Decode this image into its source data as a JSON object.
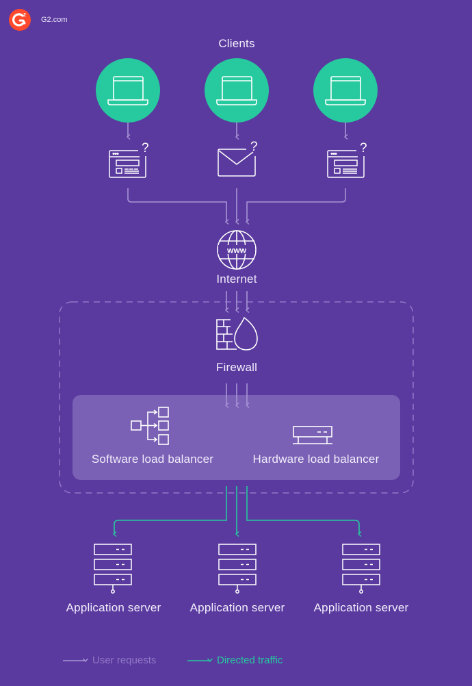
{
  "brand": {
    "label": "G2.com",
    "logo_icon": "g2-logo-icon",
    "logo_color": "#ff492c"
  },
  "colors": {
    "background": "#5a3a9e",
    "client_circle": "#27c99f",
    "user_request_arrow": "#a894d6",
    "directed_traffic_arrow": "#27c99f",
    "lb_panel": "#7a61b5"
  },
  "clients": {
    "title": "Clients",
    "items": [
      {
        "device": "laptop-icon",
        "request": "browser-window-icon",
        "badge": "?"
      },
      {
        "device": "laptop-icon",
        "request": "envelope-icon",
        "badge": "?"
      },
      {
        "device": "laptop-icon",
        "request": "browser-window-icon",
        "badge": "?"
      }
    ]
  },
  "internet": {
    "label": "Internet",
    "icon": "globe-www-icon",
    "icon_text": "www"
  },
  "firewall": {
    "label": "Firewall",
    "icon": "firewall-icon"
  },
  "load_balancers": [
    {
      "label": "Software load balancer",
      "icon": "tree-distribution-icon"
    },
    {
      "label": "Hardware load balancer",
      "icon": "hardware-device-icon"
    }
  ],
  "servers": [
    {
      "label": "Application server",
      "icon": "server-stack-icon"
    },
    {
      "label": "Application server",
      "icon": "server-stack-icon"
    },
    {
      "label": "Application server",
      "icon": "server-stack-icon"
    }
  ],
  "legend": [
    {
      "label": "User requests",
      "type": "user-requests"
    },
    {
      "label": "Directed traffic",
      "type": "directed-traffic"
    }
  ]
}
